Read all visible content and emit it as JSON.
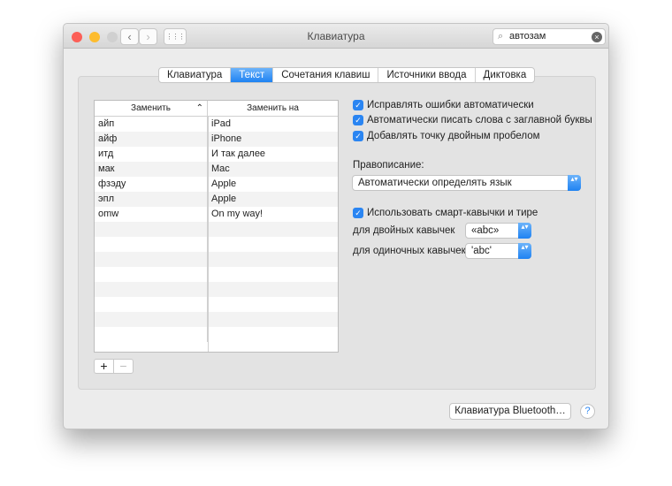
{
  "window": {
    "title": "Клавиатура"
  },
  "toolbar": {
    "back": "‹",
    "forward": "›",
    "grid": "⋮⋮⋮",
    "search_value": "автозам",
    "search_icon": "⌕",
    "clear_icon": "×"
  },
  "tabs": [
    "Клавиатура",
    "Текст",
    "Сочетания клавиш",
    "Источники ввода",
    "Диктовка"
  ],
  "table": {
    "col_replace": "Заменить",
    "col_with": "Заменить на",
    "sort_icon": "⌃",
    "rows": [
      [
        "айп",
        "iPad"
      ],
      [
        "айф",
        "iPhone"
      ],
      [
        "итд",
        "И так далее"
      ],
      [
        "мак",
        "Mac"
      ],
      [
        "фзэду",
        "Apple"
      ],
      [
        "эпл",
        "Apple"
      ],
      [
        "omw",
        "On my way!"
      ]
    ]
  },
  "add_label": "+",
  "remove_label": "−",
  "options": {
    "autocorrect": "Исправлять ошибки автоматически",
    "capitalize": "Автоматически писать слова с заглавной буквы",
    "period": "Добавлять точку двойным пробелом",
    "spelling_label": "Правописание:",
    "spelling_value": "Автоматически определять язык",
    "smart_quotes": "Использовать смарт-кавычки и тире",
    "double_label": "для двойных кавычек",
    "double_value": "«abc»",
    "single_label": "для одиночных кавычек",
    "single_value": "'abc'"
  },
  "bluetooth_button": "Клавиатура Bluetooth…",
  "help": "?",
  "check": "✓",
  "updown": "▴▾"
}
